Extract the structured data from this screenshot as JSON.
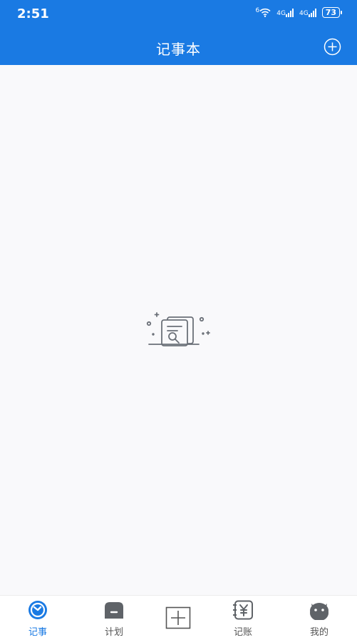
{
  "status_bar": {
    "time": "2:51",
    "wifi_badge": "6",
    "net1": "4G",
    "net2": "4G",
    "battery": "73"
  },
  "header": {
    "title": "记事本",
    "add_icon": "plus-circle-icon"
  },
  "content": {
    "empty_icon": "empty-document-search-icon"
  },
  "tabbar": {
    "accent": "#1a7ae3",
    "items": [
      {
        "label": "记事",
        "icon": "clock-icon",
        "active": true
      },
      {
        "label": "计划",
        "icon": "plan-icon",
        "active": false
      },
      {
        "label": "",
        "icon": "add-square-icon",
        "active": false
      },
      {
        "label": "记账",
        "icon": "yuan-notebook-icon",
        "active": false
      },
      {
        "label": "我的",
        "icon": "profile-face-icon",
        "active": false
      }
    ]
  }
}
